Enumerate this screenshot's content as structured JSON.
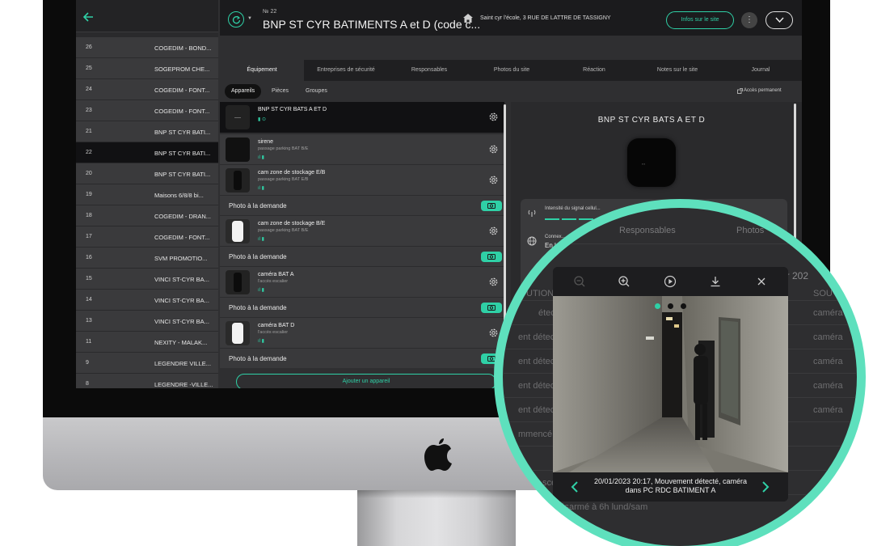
{
  "header": {
    "site_number": "№ 22",
    "site_title": "BNP ST CYR BATIMENTS A et D (code c...",
    "address": "Saint cyr l'école, 3 RUE DE LATTRE DE TASSIGNY",
    "info_button": "Infos sur le site",
    "more_button": "⋮"
  },
  "site_list": [
    {
      "num": "26",
      "name": "COGEDIM - BOND..."
    },
    {
      "num": "25",
      "name": "SOGEPROM CHE..."
    },
    {
      "num": "24",
      "name": "COGEDIM - FONT..."
    },
    {
      "num": "23",
      "name": "COGEDIM - FONT..."
    },
    {
      "num": "21",
      "name": "BNP ST CYR BATI..."
    },
    {
      "num": "22",
      "name": "BNP ST CYR BATI..."
    },
    {
      "num": "20",
      "name": "BNP ST CYR BATI..."
    },
    {
      "num": "19",
      "name": "Maisons 6/8/8 bi..."
    },
    {
      "num": "18",
      "name": "COGEDIM - DRAN..."
    },
    {
      "num": "17",
      "name": "COGEDIM - FONT..."
    },
    {
      "num": "16",
      "name": "SVM PROMOTIO..."
    },
    {
      "num": "15",
      "name": "VINCI ST-CYR BA..."
    },
    {
      "num": "14",
      "name": "VINCI ST-CYR BA..."
    },
    {
      "num": "13",
      "name": "VINCI ST-CYR BA..."
    },
    {
      "num": "11",
      "name": "NEXITY - MALAK..."
    },
    {
      "num": "9",
      "name": "LEGENDRE VILLE..."
    },
    {
      "num": "8",
      "name": "LEGENDRE -VILLE..."
    }
  ],
  "tabs": [
    "Équipement",
    "Entreprises de sécurité",
    "Responsables",
    "Photos du site",
    "Réaction",
    "Notes sur le site",
    "Journal"
  ],
  "subtabs": [
    "Appareils",
    "Pièces",
    "Groupes"
  ],
  "permanent_access": "Accès permanent",
  "hub": {
    "name": "BNP ST CYR BATS A ET D"
  },
  "devices": [
    {
      "name": "sirene",
      "location": "passage parking BAT B/E"
    },
    {
      "name": "cam zone de stockage E/B",
      "location": "passage parking BAT E/B"
    },
    {
      "name": "cam zone de stockage B/E",
      "location": "passage parking BAT B/E"
    },
    {
      "name": "caméra BAT A",
      "location": "l'accès escalier"
    },
    {
      "name": "caméra BAT D",
      "location": "l'accès escalier"
    }
  ],
  "photo_on_demand": "Photo à la demande",
  "add_device": "Ajouter un appareil",
  "details": {
    "title": "BNP ST CYR BATS A ET D",
    "signal_label": "Intensité du signal cellul...",
    "connection_label": "Connex...",
    "connection_value": "En l..."
  },
  "viewer": {
    "caption_line1": "20/01/2023 20:17, Mouvement détecté, caméra",
    "caption_line2": "dans PC RDC BATIMENT A"
  },
  "background_log": {
    "tab_responsables": "Responsables",
    "tab_photos": "Photos",
    "col_date": "er 202",
    "col_solution": "UTION",
    "col_source": "SOU",
    "rows": [
      {
        "event": "étecté, ca",
        "source": "caméra"
      },
      {
        "event": "ent détecté, ca",
        "source": "caméra"
      },
      {
        "event": "ent détecté, ca",
        "source": "caméra"
      },
      {
        "event": "ent détecté, ca",
        "source": "caméra"
      },
      {
        "event": "ent détecté, ca",
        "source": "caméra"
      },
      {
        "event": "mmencé",
        "source": ""
      },
      {
        "event": "",
        "source": ""
      },
      {
        "event": "scénario lundi à vend armé 19H",
        "source": ""
      },
      {
        "event": "rie désarmé à 6h lund/sam",
        "source": ""
      }
    ]
  },
  "colors": {
    "accent": "#2fd0a6",
    "ring": "#5ee0bd"
  }
}
